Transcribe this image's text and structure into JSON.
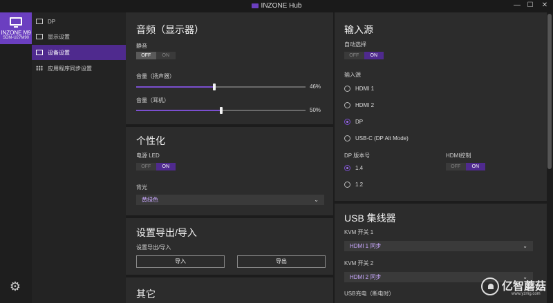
{
  "window": {
    "title": "INZONE Hub",
    "minimize": "—",
    "maximize": "☐",
    "close": "✕"
  },
  "device": {
    "name": "INZONE M9",
    "model": "SDM-U27M90"
  },
  "nav": {
    "input_label": "DP",
    "items": [
      "显示设置",
      "设备设置",
      "应用程序同步设置"
    ],
    "active_index": 1
  },
  "audio": {
    "heading": "音频（显示器）",
    "mute_label": "静音",
    "mute_value": "OFF",
    "speaker_label": "音量（扬声器）",
    "speaker_value": "46%",
    "speaker_level": 46,
    "headphone_label": "音量（耳机）",
    "headphone_value": "50%",
    "headphone_level": 50
  },
  "personalize": {
    "heading": "个性化",
    "power_led_label": "电源 LED",
    "power_led_value": "ON",
    "backlight_label": "背光",
    "backlight_value": "黄绿色"
  },
  "export": {
    "heading": "设置导出/导入",
    "sub_label": "设置导出/导入",
    "import_button": "导入",
    "export_button": "导出"
  },
  "other": {
    "heading": "其它"
  },
  "toggle_text": {
    "off": "OFF",
    "on": "ON"
  },
  "input_source": {
    "heading": "输入源",
    "auto_label": "自动选择",
    "auto_value": "ON",
    "source_label": "输入源",
    "sources": [
      "HDMI 1",
      "HDMI 2",
      "DP",
      "USB-C (DP Alt Mode)"
    ],
    "selected_source": "DP",
    "dp_version_label": "DP 版本号",
    "dp_versions": [
      "1.4",
      "1.2"
    ],
    "selected_dp_version": "1.4",
    "hdmi_control_label": "HDMI控制",
    "hdmi_control_value": "ON"
  },
  "usb_hub": {
    "heading": "USB 集线器",
    "kvm1_label": "KVM 开关 1",
    "kvm1_value": "HDMI 1 同步",
    "kvm2_label": "KVM 开关 2",
    "kvm2_value": "HDMI 2 同步",
    "usb_charge_label": "USB充电（断电时）"
  },
  "watermark": {
    "text": "亿智蘑菇",
    "url": "www.yzmg.com"
  },
  "colors": {
    "accent": "#6b3fc0",
    "accent_dark": "#4f2a8e",
    "panel": "#2c2c2c"
  },
  "icons": [
    "monitor-icon",
    "input-icon",
    "image-icon",
    "display-icon",
    "grid-icon",
    "gear-icon"
  ]
}
